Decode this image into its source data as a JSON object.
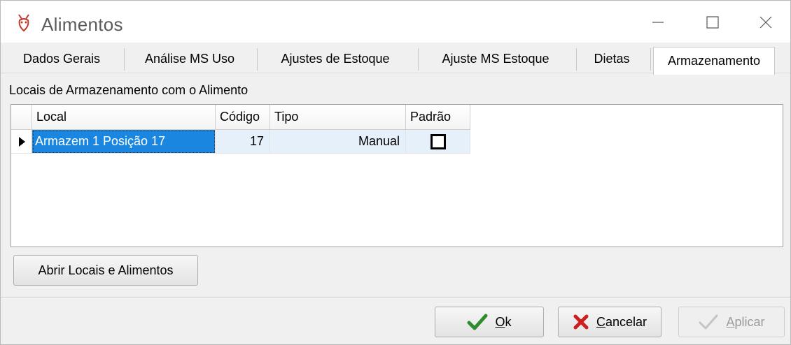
{
  "window": {
    "title": "Alimentos",
    "controls": {
      "minimize": "minimize-icon",
      "maximize": "maximize-icon",
      "close": "close-icon"
    }
  },
  "tabs": [
    {
      "label": "Dados Gerais",
      "active": false
    },
    {
      "label": "Análise MS Uso",
      "active": false
    },
    {
      "label": "Ajustes de Estoque",
      "active": false
    },
    {
      "label": "Ajuste MS Estoque",
      "active": false
    },
    {
      "label": "Dietas",
      "active": false
    },
    {
      "label": "Armazenamento",
      "active": true
    }
  ],
  "section": {
    "label": "Locais de Armazenamento com o Alimento"
  },
  "grid": {
    "columns": [
      "Local",
      "Código",
      "Tipo",
      "Padrão"
    ],
    "rows": [
      {
        "local": "Armazem 1 Posição 17",
        "codigo": "17",
        "tipo": "Manual",
        "padrao": false
      }
    ]
  },
  "buttons": {
    "open_locais": "Abrir Locais e Alimentos",
    "ok": {
      "prefix": "",
      "hotkey": "O",
      "rest": "k"
    },
    "cancel": {
      "hotkey": "C",
      "rest": "ancelar"
    },
    "apply": {
      "hotkey": "A",
      "rest": "plicar"
    }
  },
  "colors": {
    "selection": "#1a86e0",
    "row_bg": "#e6f0fb",
    "ok_check": "#2e8b2e",
    "cancel_x": "#cc1f1f",
    "app_icon": "#c0392b"
  }
}
